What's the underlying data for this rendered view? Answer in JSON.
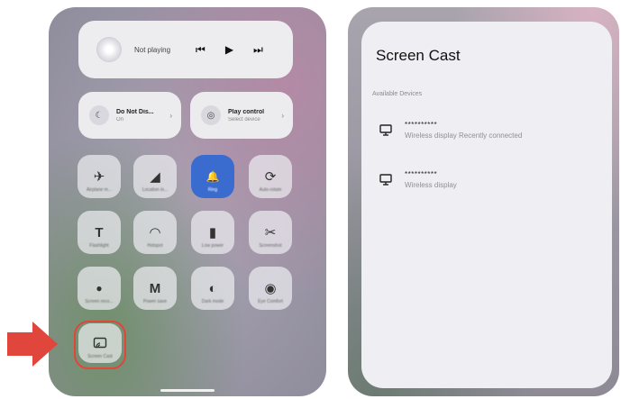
{
  "control_center": {
    "media": {
      "title": "Not playing",
      "prev": "⏮",
      "play": "▶",
      "next": "⏭"
    },
    "do_not_disturb": {
      "title": "Do Not Dis...",
      "sub": "On",
      "icon": "moon-icon"
    },
    "play_control": {
      "title": "Play control",
      "sub": "Select device",
      "icon": "cast-icon"
    },
    "tiles": [
      {
        "label": "Airplane m...",
        "glyph": "✈",
        "icon": "airplane-icon",
        "active": false
      },
      {
        "label": "Location in...",
        "glyph": "◢",
        "icon": "location-icon",
        "active": false
      },
      {
        "label": "Ring",
        "glyph": "🔔",
        "icon": "bell-icon",
        "active": true
      },
      {
        "label": "Auto-rotate",
        "glyph": "⟳",
        "icon": "rotate-icon",
        "active": false
      },
      {
        "label": "Flashlight",
        "glyph": "T",
        "icon": "flashlight-icon",
        "active": false
      },
      {
        "label": "Hotspot",
        "glyph": "◠",
        "icon": "hotspot-icon",
        "active": false
      },
      {
        "label": "Low power",
        "glyph": "▮",
        "icon": "battery-icon",
        "active": false
      },
      {
        "label": "Screenshot",
        "glyph": "✂",
        "icon": "scissors-icon",
        "active": false
      },
      {
        "label": "Screen reco...",
        "glyph": "●",
        "icon": "record-icon",
        "active": false
      },
      {
        "label": "Power save",
        "glyph": "M",
        "icon": "mail-icon",
        "active": false
      },
      {
        "label": "Dark mode",
        "glyph": "◐",
        "icon": "dark-mode-icon",
        "active": false
      },
      {
        "label": "Eye Comfort",
        "glyph": "◉",
        "icon": "eye-icon",
        "active": false
      }
    ],
    "cast_tile": {
      "label": "Screen Cast",
      "icon": "screen-cast-icon"
    }
  },
  "screen_cast": {
    "title": "Screen Cast",
    "section": "Available Devices",
    "devices": [
      {
        "name": "**********",
        "sub": "Wireless display Recently connected",
        "icon": "monitor-icon"
      },
      {
        "name": "**********",
        "sub": "Wireless display",
        "icon": "monitor-icon"
      }
    ]
  },
  "colors": {
    "active_tile": "#3a6cd0",
    "highlight": "#e0463c",
    "arrow": "#e0463c"
  }
}
